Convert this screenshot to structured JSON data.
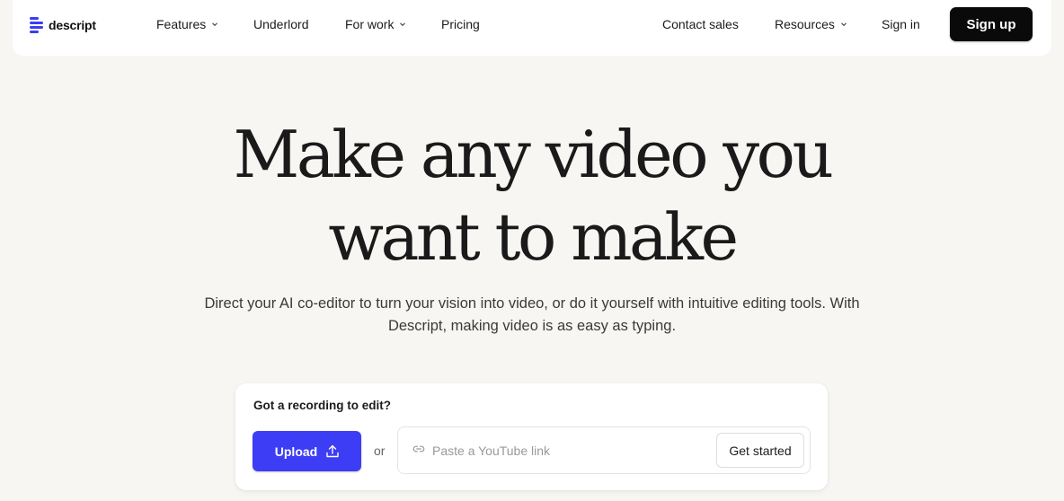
{
  "brand": {
    "name": "descript",
    "accent": "#3d3df5"
  },
  "nav": {
    "left": [
      {
        "label": "Features",
        "dropdown": true
      },
      {
        "label": "Underlord",
        "dropdown": false
      },
      {
        "label": "For work",
        "dropdown": true
      },
      {
        "label": "Pricing",
        "dropdown": false
      }
    ],
    "right": [
      {
        "label": "Contact sales",
        "dropdown": false
      },
      {
        "label": "Resources",
        "dropdown": true
      },
      {
        "label": "Sign in",
        "dropdown": false
      }
    ],
    "signup_label": "Sign up"
  },
  "hero": {
    "headline_line1": "Make any video you",
    "headline_line2": "want to make",
    "subhead_line1": "Direct your AI co-editor to turn your vision into video, or do it yourself with intuitive editing tools. With",
    "subhead_line2": "Descript, making video is as easy as typing."
  },
  "card": {
    "title": "Got a recording to edit?",
    "upload_label": "Upload",
    "or_label": "or",
    "youtube_placeholder": "Paste a YouTube link",
    "get_started_label": "Get started"
  }
}
